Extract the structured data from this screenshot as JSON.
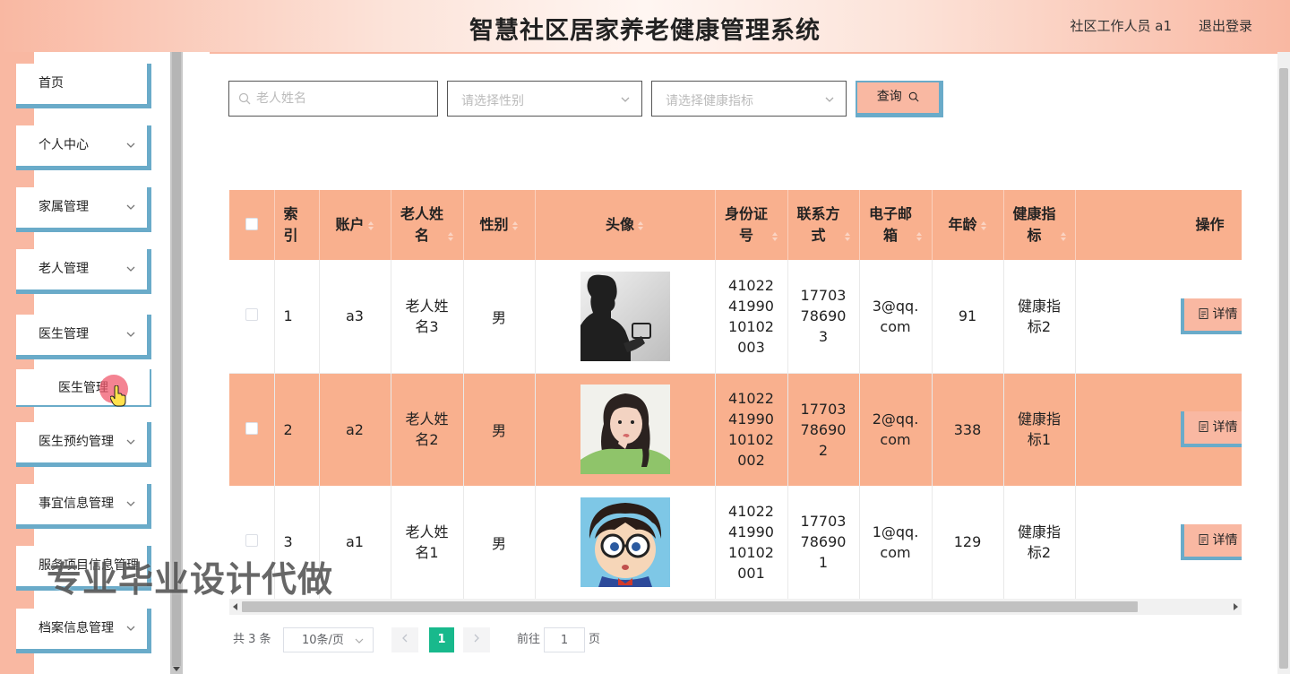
{
  "header": {
    "title": "智慧社区居家养老健康管理系统",
    "user": "社区工作人员 a1",
    "logout": "退出登录"
  },
  "sidebar": {
    "items": [
      {
        "label": "首页",
        "has_chevron": false
      },
      {
        "label": "个人中心",
        "has_chevron": true
      },
      {
        "label": "家属管理",
        "has_chevron": true
      },
      {
        "label": "老人管理",
        "has_chevron": true
      },
      {
        "label": "医生管理",
        "has_chevron": true,
        "expanded": true
      },
      {
        "label": "医生预约管理",
        "has_chevron": true
      },
      {
        "label": "事宜信息管理",
        "has_chevron": true
      },
      {
        "label": "服务项目信息管理",
        "has_chevron": true
      },
      {
        "label": "档案信息管理",
        "has_chevron": true
      }
    ],
    "sub_item": "医生管理"
  },
  "filters": {
    "name_placeholder": "老人姓名",
    "gender_placeholder": "请选择性别",
    "health_placeholder": "请选择健康指标",
    "query_label": "查询"
  },
  "table": {
    "columns": [
      "索引",
      "账户",
      "老人姓名",
      "性别",
      "头像",
      "身份证号",
      "联系方式",
      "电子邮箱",
      "年龄",
      "健康指标",
      "操作"
    ],
    "rows": [
      {
        "index": "1",
        "account": "a3",
        "name": "老人姓名3",
        "gender": "男",
        "avatar": "man-silhouette-photo",
        "id_card": "410224199010102003",
        "phone": "17703786903",
        "email": "3@qq.com",
        "age": "91",
        "health": "健康指标2",
        "action": "详情"
      },
      {
        "index": "2",
        "account": "a2",
        "name": "老人姓名2",
        "gender": "男",
        "avatar": "girl-green-sweater-photo",
        "id_card": "410224199010102002",
        "phone": "17703786902",
        "email": "2@qq.com",
        "age": "338",
        "health": "健康指标1",
        "action": "详情"
      },
      {
        "index": "3",
        "account": "a1",
        "name": "老人姓名1",
        "gender": "男",
        "avatar": "cartoon-boy-glasses",
        "id_card": "410224199010102001",
        "phone": "17703786901",
        "email": "1@qq.com",
        "age": "129",
        "health": "健康指标2",
        "action": "详情"
      }
    ]
  },
  "pagination": {
    "total": "共 3 条",
    "page_size": "10条/页",
    "current": "1",
    "goto_label": "前往",
    "goto_value": "1",
    "page_label": "页"
  },
  "watermark": "专业毕业设计代做",
  "colors": {
    "accent": "#f9b08e",
    "border_blue": "#6aabc9",
    "page_active": "#18b98c"
  }
}
